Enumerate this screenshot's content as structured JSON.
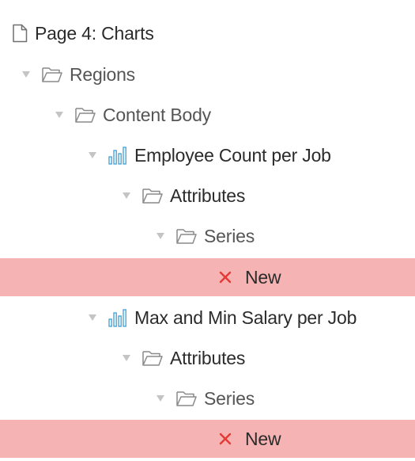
{
  "tree": {
    "page": {
      "label": "Page 4: Charts",
      "icon": "page-icon"
    },
    "regions": {
      "label": "Regions",
      "icon": "folder-icon"
    },
    "content_body": {
      "label": "Content Body",
      "icon": "folder-icon"
    },
    "chart1": {
      "label": "Employee Count per Job",
      "icon": "bar-chart-icon",
      "attributes": {
        "label": "Attributes"
      },
      "series": {
        "label": "Series"
      },
      "error_item": {
        "label": "New",
        "icon": "error-x-icon"
      }
    },
    "chart2": {
      "label": "Max and Min Salary per Job",
      "icon": "bar-chart-icon",
      "attributes": {
        "label": "Attributes"
      },
      "series": {
        "label": "Series"
      },
      "error_item": {
        "label": "New",
        "icon": "error-x-icon"
      }
    }
  },
  "colors": {
    "error_row": "#f6b3b3",
    "error_x": "#e53935",
    "chart_icon": "#3aa0d8",
    "folder_stroke": "#8a8a8a",
    "toggle": "#c4c4c4"
  }
}
